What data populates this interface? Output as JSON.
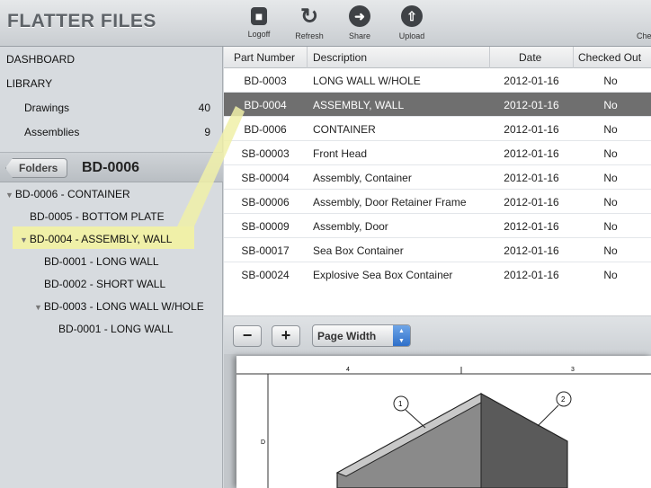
{
  "app": {
    "title": "FLATTER FILES"
  },
  "toolbar": {
    "logoff": "Logoff",
    "refresh": "Refresh",
    "share": "Share",
    "upload": "Upload",
    "checkout_partial": "Che"
  },
  "sidebar": {
    "dashboard": "DASHBOARD",
    "library": "LIBRARY",
    "items": [
      {
        "label": "Drawings",
        "count": "40"
      },
      {
        "label": "Assemblies",
        "count": "9"
      }
    ]
  },
  "folder": {
    "back_label": "Folders",
    "title": "BD-0006"
  },
  "tree": [
    "BD-0006 - CONTAINER",
    "BD-0005 - BOTTOM PLATE",
    "BD-0004 - ASSEMBLY, WALL",
    "BD-0001 - LONG WALL",
    "BD-0002 - SHORT WALL",
    "BD-0003 - LONG WALL W/HOLE",
    "BD-0001 - LONG WALL"
  ],
  "table": {
    "headers": [
      "Part Number",
      "Description",
      "Date",
      "Checked Out"
    ],
    "rows": [
      [
        "BD-0003",
        "LONG WALL W/HOLE",
        "2012-01-16",
        "No"
      ],
      [
        "BD-0004",
        "ASSEMBLY, WALL",
        "2012-01-16",
        "No"
      ],
      [
        "BD-0006",
        "CONTAINER",
        "2012-01-16",
        "No"
      ],
      [
        "SB-00003",
        "Front Head",
        "2012-01-16",
        "No"
      ],
      [
        "SB-00004",
        "Assembly, Container",
        "2012-01-16",
        "No"
      ],
      [
        "SB-00006",
        "Assembly, Door Retainer Frame",
        "2012-01-16",
        "No"
      ],
      [
        "SB-00009",
        "Assembly, Door",
        "2012-01-16",
        "No"
      ],
      [
        "SB-00017",
        "Sea Box Container",
        "2012-01-16",
        "No"
      ],
      [
        "SB-00024",
        "Explosive Sea Box Container",
        "2012-01-16",
        "No"
      ]
    ]
  },
  "viewer": {
    "zoom_out": "−",
    "zoom_in": "+",
    "zoom_value": "Page Width",
    "drawing": {
      "zone_4": "4",
      "zone_3": "3",
      "zone_d": "D",
      "balloon_1": "1",
      "balloon_2": "2"
    }
  },
  "colors": {
    "selected_row": "#6f6f6f",
    "tree_highlight": "#f0f0a8"
  }
}
